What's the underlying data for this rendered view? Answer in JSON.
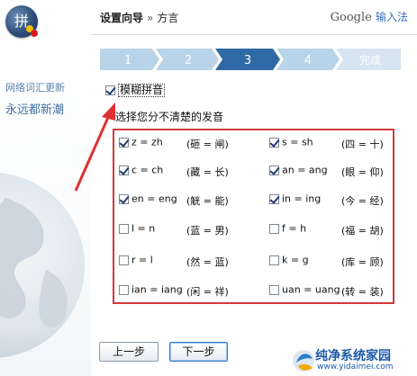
{
  "sidebar": {
    "logo_glyph": "拼",
    "line1": "网络词汇更新",
    "line2": "永远都新潮"
  },
  "header": {
    "crumb_main": "设置向导",
    "crumb_sep": "»",
    "crumb_sub": "方言",
    "brand_google": "Google",
    "brand_ime": "输入法"
  },
  "steps": {
    "items": [
      "1",
      "2",
      "3",
      "4",
      "完成"
    ],
    "active_index": 2
  },
  "fuzzy": {
    "checked": true,
    "label": "模糊拼音"
  },
  "hint": "选择您分不清楚的发音",
  "pairs": [
    {
      "rule": "z = zh",
      "example": "(砸 = 闸)",
      "checked": true
    },
    {
      "rule": "s = sh",
      "example": "(四 = 十)",
      "checked": true
    },
    {
      "rule": "c = ch",
      "example": "(藏 = 长)",
      "checked": true
    },
    {
      "rule": "an = ang",
      "example": "(眼 = 仰)",
      "checked": true
    },
    {
      "rule": "en = eng",
      "example": "(觥 = 能)",
      "checked": true
    },
    {
      "rule": "in = ing",
      "example": "(今 = 经)",
      "checked": true
    },
    {
      "rule": "l = n",
      "example": "(蓝 = 男)",
      "checked": false
    },
    {
      "rule": "f = h",
      "example": "(福 = 胡)",
      "checked": false
    },
    {
      "rule": "r = l",
      "example": "(然 = 蓝)",
      "checked": false
    },
    {
      "rule": "k = g",
      "example": "(库 = 顾)",
      "checked": false
    },
    {
      "rule": "ian = iang",
      "example": "(闲 = 祥)",
      "checked": false
    },
    {
      "rule": "uan = uang",
      "example": "(转 = 装)",
      "checked": false
    }
  ],
  "buttons": {
    "prev": "上一步",
    "next": "下一步"
  },
  "watermark": {
    "title": "纯净系统家园",
    "url": "www.yidaimei.com"
  },
  "colors": {
    "step_active": "#2f6aa6",
    "step_inactive": "#b9d3e8",
    "highlight_red": "#d23a3a"
  }
}
